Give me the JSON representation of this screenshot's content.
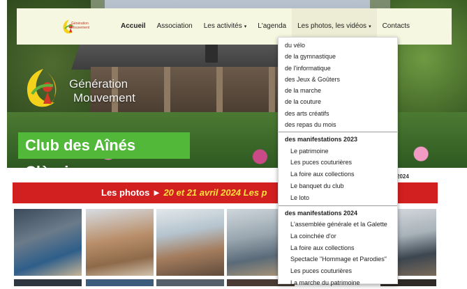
{
  "nav": {
    "logo_text": "Génération Mouvement",
    "items": [
      {
        "label": "Accueil",
        "active": true
      },
      {
        "label": "Association"
      },
      {
        "label": "Les activités",
        "caret": "▾"
      },
      {
        "label": "L'agenda"
      },
      {
        "label": "Les photos, les vidéos",
        "caret": "▾",
        "open": true
      },
      {
        "label": "Contacts"
      }
    ]
  },
  "hero": {
    "logo_line1": "Génération",
    "logo_line2": "Mouvement",
    "club_title": "Club des Aînés Clèrois"
  },
  "dropdown": {
    "activities": [
      "du vélo",
      "de la gymnastique",
      "de l'informatique",
      "des Jeux & Goûters",
      "de la marche",
      "de la couture",
      "des arts créatifs",
      "des repas du mois"
    ],
    "group_2023": {
      "heading": "des manifestations 2023",
      "items": [
        "Le patrimoine",
        "Les puces couturières",
        "La foire aux collections",
        "Le banquet du club",
        "Le loto"
      ]
    },
    "group_2024": {
      "heading": "des manifestations 2024",
      "items": [
        "L'assemblée générale et la Galette",
        "La coinchée d'or",
        "La foire aux collections",
        "Spectacle \"Hommage et Parodies\"",
        "Les puces couturières",
        "La marche du patrimoine"
      ]
    }
  },
  "section": {
    "year_fragment": "2024",
    "banner_lead": "Les photos ►",
    "banner_date": "20 et 21  avril 2024",
    "banner_tail": "Les p"
  }
}
